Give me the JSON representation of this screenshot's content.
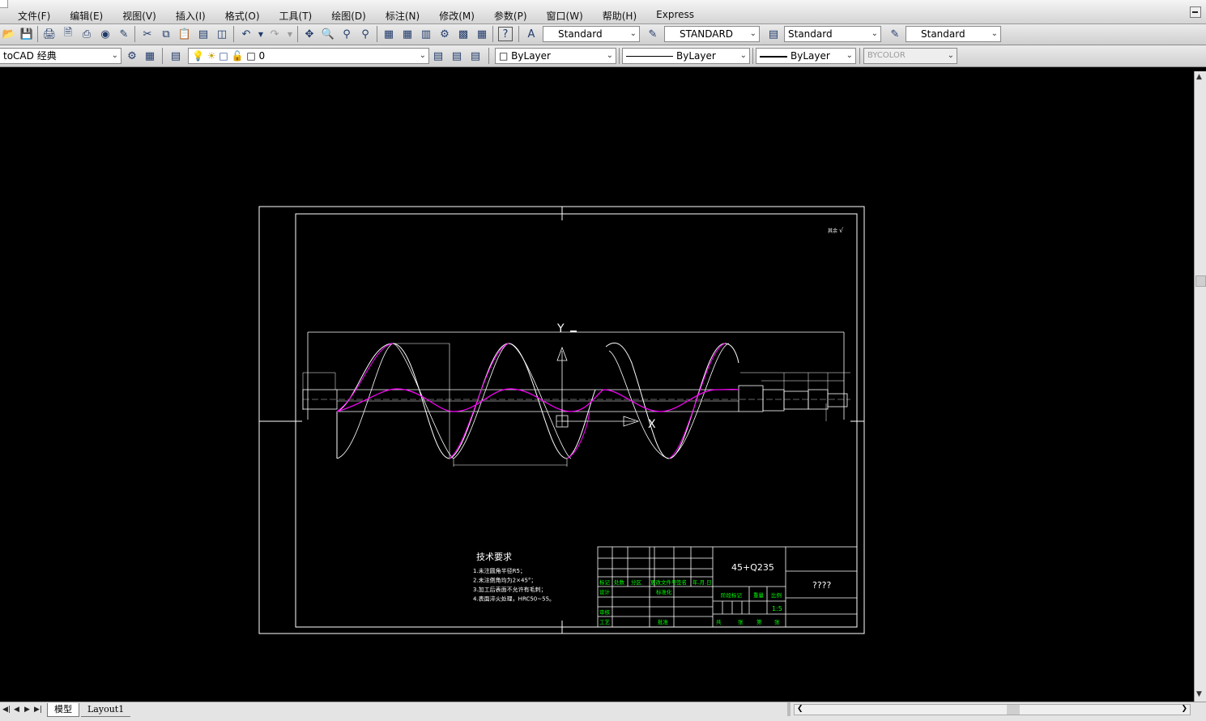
{
  "menu": {
    "items": [
      "文件(F)",
      "编辑(E)",
      "视图(V)",
      "插入(I)",
      "格式(O)",
      "工具(T)",
      "绘图(D)",
      "标注(N)",
      "修改(M)",
      "参数(P)",
      "窗口(W)",
      "帮助(H)",
      "Express"
    ]
  },
  "toolbar1": {
    "text_style": "Standard",
    "dim_style": "STANDARD",
    "table_style": "Standard",
    "multileader_style": "Standard"
  },
  "toolbar2": {
    "workspace": "toCAD 经典",
    "layer": "0",
    "color": "ByLayer",
    "linetype": "ByLayer",
    "lineweight": "ByLayer",
    "plotstyle": "BYCOLOR"
  },
  "drawing": {
    "axis_y": "Y",
    "axis_x": "X",
    "tech_title": "技术要求",
    "tech_lines": [
      "1.未注圆角半径R5；",
      "2.未注倒角均为2×45°；",
      "3.加工后表面不允许有毛刺；",
      "4.表面淬火处理，HRC50~55。"
    ],
    "material": "45+Q235",
    "drawing_name": "????",
    "scale": "1:5",
    "roughness_note": "其余",
    "title_block_labels": [
      "标记",
      "处数",
      "分区",
      "更改文件号",
      "签名",
      "年.月.日",
      "设计",
      "标准化",
      "审核",
      "工艺",
      "批准",
      "阶段标记",
      "重量",
      "比例",
      "共",
      "张",
      "第",
      "张"
    ]
  },
  "tabs": {
    "model": "模型",
    "layout1": "Layout1"
  }
}
